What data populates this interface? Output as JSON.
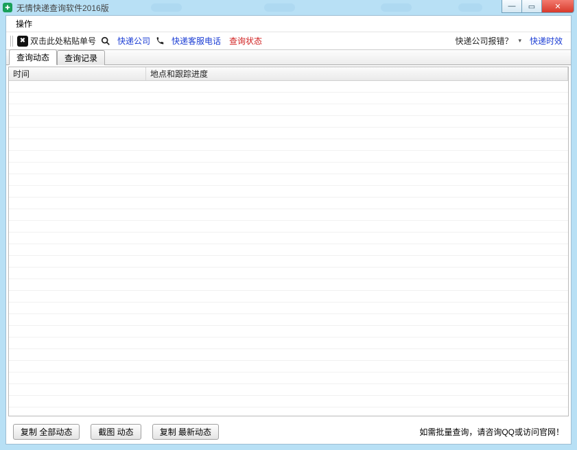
{
  "title": "无情快递查询软件2016版",
  "menu": {
    "operate": "操作"
  },
  "toolbar": {
    "paste_hint": "双击此处粘贴单号",
    "company": "快递公司",
    "phone": "快递客服电话",
    "status": "查询状态",
    "report_error": "快递公司报错？",
    "timing": "快递时效"
  },
  "tabs": {
    "active": "查询动态",
    "history": "查询记录"
  },
  "columns": {
    "time": "时间",
    "location": "地点和跟踪进度"
  },
  "footer": {
    "copy_all": "复制 全部动态",
    "screenshot": "截图 动态",
    "copy_latest": "复制 最新动态",
    "note": "如需批量查询，请咨询QQ或访问官网！"
  }
}
